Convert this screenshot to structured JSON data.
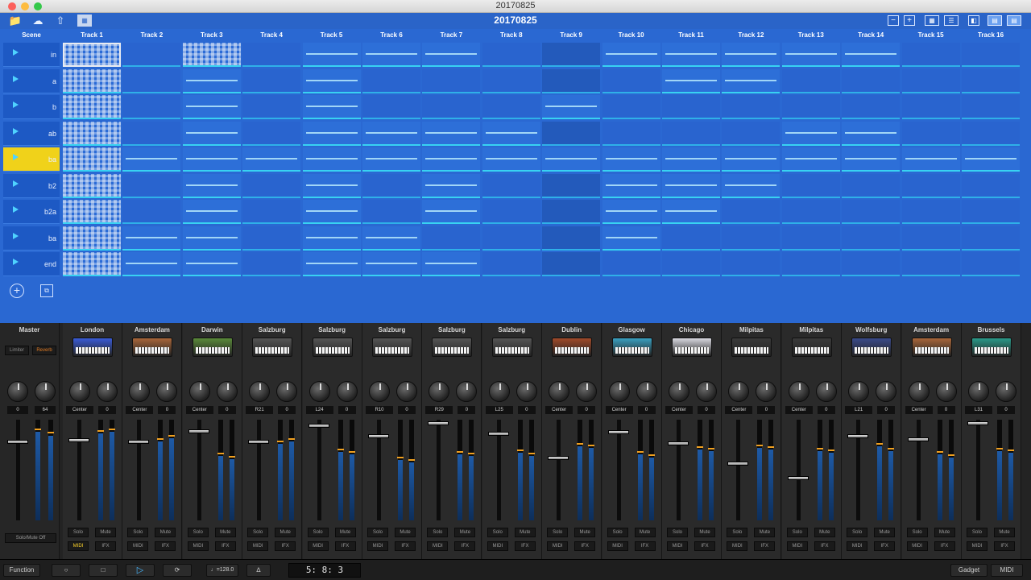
{
  "window": {
    "title": "20170825"
  },
  "song": {
    "name": "20170825"
  },
  "scene_header": "Scene",
  "tracks": [
    "Track 1",
    "Track 2",
    "Track 3",
    "Track 4",
    "Track 5",
    "Track 6",
    "Track 7",
    "Track 8",
    "Track 9",
    "Track 10",
    "Track 11",
    "Track 12",
    "Track 13",
    "Track 14",
    "Track 15",
    "Track 16"
  ],
  "scenes": [
    {
      "name": "in",
      "active": false
    },
    {
      "name": "a",
      "active": false
    },
    {
      "name": "b",
      "active": false
    },
    {
      "name": "ab",
      "active": false
    },
    {
      "name": "ba",
      "active": true
    },
    {
      "name": "b2",
      "active": false
    },
    {
      "name": "b2a",
      "active": false
    },
    {
      "name": "ba",
      "active": false
    },
    {
      "name": "end",
      "active": false
    }
  ],
  "mixer": {
    "master": {
      "label": "Master",
      "limiter": "Limiter",
      "reverb": "Reverb",
      "values": [
        "0",
        "64"
      ],
      "solo_mute_off": "Solo/Mute Off"
    },
    "channels": [
      {
        "name": "London",
        "pan": "Center",
        "send": "0",
        "midi_on": true
      },
      {
        "name": "Amsterdam",
        "pan": "Center",
        "send": "0",
        "midi_on": false
      },
      {
        "name": "Darwin",
        "pan": "Center",
        "send": "0",
        "midi_on": false
      },
      {
        "name": "Salzburg",
        "pan": "R21",
        "send": "0",
        "midi_on": false
      },
      {
        "name": "Salzburg",
        "pan": "L24",
        "send": "0",
        "midi_on": false
      },
      {
        "name": "Salzburg",
        "pan": "R10",
        "send": "0",
        "midi_on": false
      },
      {
        "name": "Salzburg",
        "pan": "R29",
        "send": "0",
        "midi_on": false
      },
      {
        "name": "Salzburg",
        "pan": "L25",
        "send": "0",
        "midi_on": false
      },
      {
        "name": "Dublin",
        "pan": "Center",
        "send": "0",
        "midi_on": false
      },
      {
        "name": "Glasgow",
        "pan": "Center",
        "send": "0",
        "midi_on": false
      },
      {
        "name": "Chicago",
        "pan": "Center",
        "send": "0",
        "midi_on": false
      },
      {
        "name": "Milpitas",
        "pan": "Center",
        "send": "0",
        "midi_on": false
      },
      {
        "name": "Milpitas",
        "pan": "Center",
        "send": "0",
        "midi_on": false
      },
      {
        "name": "Wolfsburg",
        "pan": "L21",
        "send": "0",
        "midi_on": false
      },
      {
        "name": "Amsterdam",
        "pan": "Center",
        "send": "0",
        "midi_on": false
      },
      {
        "name": "Brussels",
        "pan": "L31",
        "send": "0",
        "midi_on": false
      }
    ],
    "solo_label": "Solo",
    "mute_label": "Mute",
    "midi_label": "MIDI",
    "ifx_label": "IFX"
  },
  "transport": {
    "function": "Function",
    "tempo": "♩=128.0",
    "position": "5:  8:  3",
    "gadget": "Gadget",
    "midi": "MIDI"
  },
  "colors": {
    "session_bg": "#2a68d2",
    "active_scene": "#f0d21a",
    "clip_line": "#38d2f2",
    "mixer_bg": "#232323"
  }
}
